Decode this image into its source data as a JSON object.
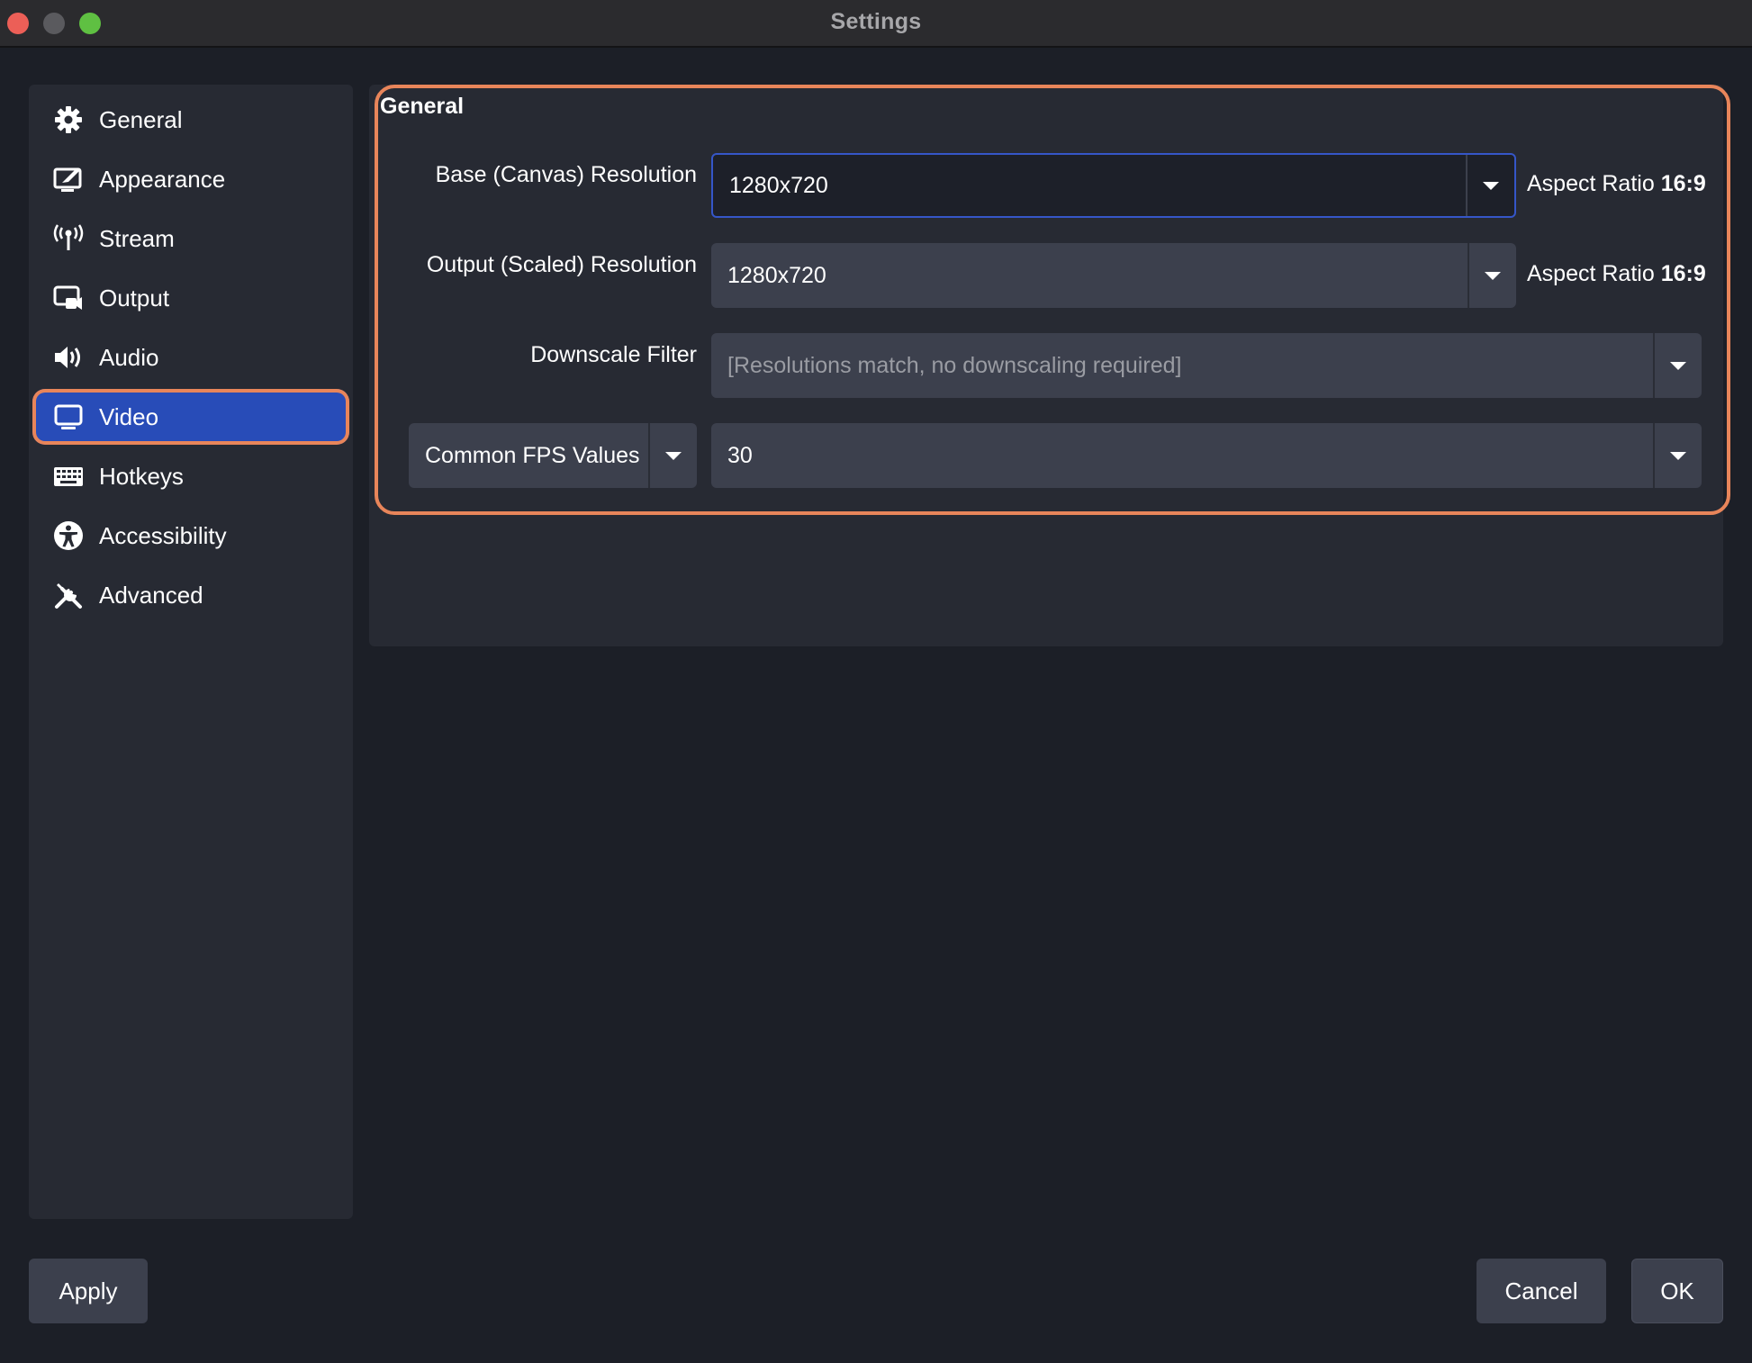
{
  "window": {
    "title": "Settings"
  },
  "sidebar": {
    "items": [
      {
        "label": "General",
        "icon": "gear-icon"
      },
      {
        "label": "Appearance",
        "icon": "appearance-icon"
      },
      {
        "label": "Stream",
        "icon": "antenna-icon"
      },
      {
        "label": "Output",
        "icon": "output-icon"
      },
      {
        "label": "Audio",
        "icon": "speaker-icon"
      },
      {
        "label": "Video",
        "icon": "monitor-icon",
        "active": true
      },
      {
        "label": "Hotkeys",
        "icon": "keyboard-icon"
      },
      {
        "label": "Accessibility",
        "icon": "accessibility-icon"
      },
      {
        "label": "Advanced",
        "icon": "tools-icon"
      }
    ]
  },
  "video": {
    "group_title": "General",
    "base_resolution": {
      "label": "Base (Canvas) Resolution",
      "value": "1280x720",
      "aspect_prefix": "Aspect Ratio",
      "aspect_value": "16:9"
    },
    "output_resolution": {
      "label": "Output (Scaled) Resolution",
      "value": "1280x720",
      "aspect_prefix": "Aspect Ratio",
      "aspect_value": "16:9"
    },
    "downscale_filter": {
      "label": "Downscale Filter",
      "value": "[Resolutions match, no downscaling required]"
    },
    "fps": {
      "mode": "Common FPS Values",
      "value": "30"
    }
  },
  "buttons": {
    "apply": "Apply",
    "cancel": "Cancel",
    "ok": "OK"
  },
  "colors": {
    "accent_highlight": "#e8855a",
    "active_item": "#284cb8",
    "background": "#1c1f27",
    "panel": "#272a33"
  }
}
